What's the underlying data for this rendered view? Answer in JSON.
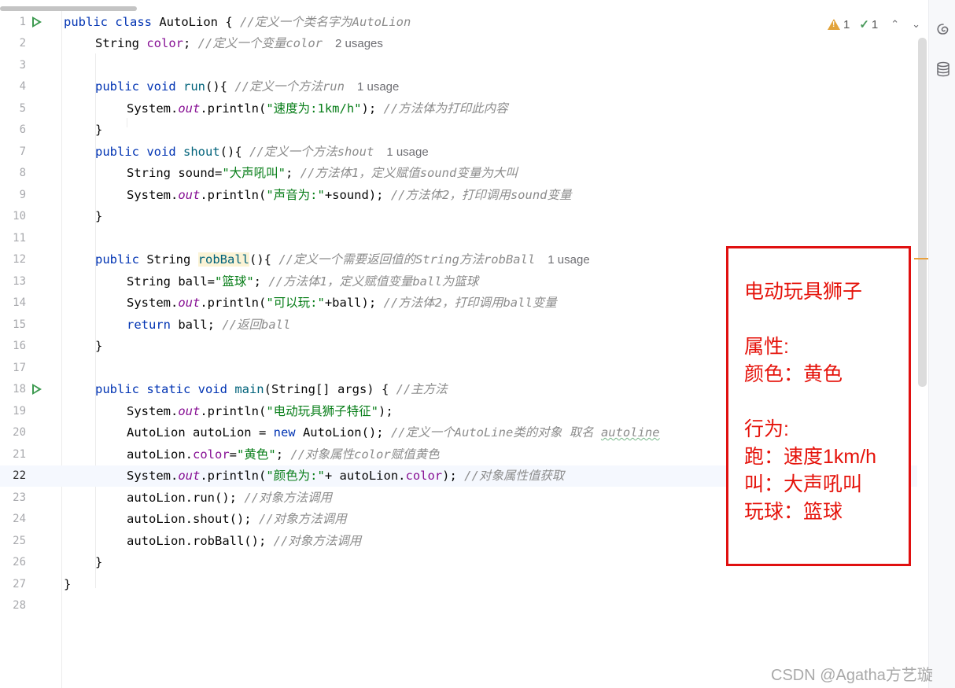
{
  "editor": {
    "usage_one": "1 usage",
    "usage_two": "2 usages",
    "current_line": 22,
    "lines": [
      {
        "n": "1",
        "run": true
      },
      {
        "n": "2"
      },
      {
        "n": "3"
      },
      {
        "n": "4"
      },
      {
        "n": "5"
      },
      {
        "n": "6"
      },
      {
        "n": "7"
      },
      {
        "n": "8"
      },
      {
        "n": "9"
      },
      {
        "n": "10"
      },
      {
        "n": "11"
      },
      {
        "n": "12"
      },
      {
        "n": "13"
      },
      {
        "n": "14"
      },
      {
        "n": "15"
      },
      {
        "n": "16"
      },
      {
        "n": "17"
      },
      {
        "n": "18",
        "run": true
      },
      {
        "n": "19"
      },
      {
        "n": "20"
      },
      {
        "n": "21"
      },
      {
        "n": "22"
      },
      {
        "n": "23"
      },
      {
        "n": "24"
      },
      {
        "n": "25"
      },
      {
        "n": "26"
      },
      {
        "n": "27"
      },
      {
        "n": "28"
      }
    ],
    "code": {
      "l1": {
        "kw": "public class ",
        "name": "AutoLion",
        "rest": " { ",
        "comment": "//定义一个类名字为AutoLion"
      },
      "l2": {
        "type": "String ",
        "field": "color",
        "rest": "; ",
        "comment": "//定义一个变量color"
      },
      "l4": {
        "kw": "public void ",
        "fn": "run",
        "rest": "(){ ",
        "comment": "//定义一个方法run"
      },
      "l5": {
        "a": "System.",
        "b": "out",
        "c": ".println(",
        "s": "\"速度为:1km/h\"",
        "d": "); ",
        "comment": "//方法体为打印此内容"
      },
      "l6": {
        "t": "}"
      },
      "l7": {
        "kw": "public void ",
        "fn": "shout",
        "rest": "(){ ",
        "comment": "//定义一个方法shout"
      },
      "l8": {
        "a": "String sound=",
        "s": "\"大声吼叫\"",
        "d": "; ",
        "comment": "//方法体1，定义赋值sound变量为大叫"
      },
      "l9": {
        "a": "System.",
        "b": "out",
        "c": ".println(",
        "s": "\"声音为:\"",
        "d": "+sound); ",
        "comment": "//方法体2，打印调用sound变量"
      },
      "l10": {
        "t": "}"
      },
      "l12": {
        "kw": "public ",
        "type": "String ",
        "fn": "robBall",
        "rest": "(){ ",
        "comment": "//定义一个需要返回值的String方法robBall"
      },
      "l13": {
        "a": "String ball=",
        "s": "\"篮球\"",
        "d": "; ",
        "comment": "//方法体1，定义赋值变量ball为篮球"
      },
      "l14": {
        "a": "System.",
        "b": "out",
        "c": ".println(",
        "s": "\"可以玩:\"",
        "d": "+ball); ",
        "comment": "//方法体2，打印调用ball变量"
      },
      "l15": {
        "kw": "return ",
        "rest": "ball; ",
        "comment": "//返回ball"
      },
      "l16": {
        "t": "}"
      },
      "l18": {
        "kw": "public static void ",
        "fn": "main",
        "rest": "(String[] args) { ",
        "comment": "//主方法"
      },
      "l19": {
        "a": "System.",
        "b": "out",
        "c": ".println(",
        "s": "\"电动玩具狮子特征\"",
        "d": ");"
      },
      "l20": {
        "a": "AutoLion autoLion = ",
        "kw": "new ",
        "rest": "AutoLion(); ",
        "comment": "//定义一个AutoLine类的对象 取名 ",
        "comment_wavy": "autoline"
      },
      "l21": {
        "a": "autoLion.",
        "field": "color",
        "b": "=",
        "s": "\"黄色\"",
        "d": "; ",
        "comment": "//对象属性color赋值黄色"
      },
      "l22": {
        "a": "System.",
        "b": "out",
        "c": ".println(",
        "s": "\"颜色为:\"",
        "d": "+ autoLion.",
        "field": "color",
        "e": "); ",
        "comment": "//对象属性值获取"
      },
      "l23": {
        "a": "autoLion.run(); ",
        "comment": "//对象方法调用"
      },
      "l24": {
        "a": "autoLion.shout(); ",
        "comment": "//对象方法调用"
      },
      "l25": {
        "a": "autoLion.robBall(); ",
        "comment": "//对象方法调用"
      },
      "l26": {
        "t": "}"
      },
      "l27": {
        "t": "}"
      }
    }
  },
  "inspections": {
    "warnings": "1",
    "checks": "1",
    "up_arrow": "⌃",
    "down_arrow": "⌄"
  },
  "annotation": {
    "title": "电动玩具狮子",
    "attributes_heading": "属性:",
    "attribute_color": "颜色：黄色",
    "behaviors_heading": "行为:",
    "behavior_run": "跑：速度1km/h",
    "behavior_shout": "叫：大声吼叫",
    "behavior_play": "玩球：篮球"
  },
  "watermark": "CSDN @Agatha方艺璇",
  "colors": {
    "keyword": "#0033b3",
    "string": "#067d17",
    "comment": "#8c8c8c",
    "field": "#871094",
    "note_red": "#e01010"
  },
  "side_icons": [
    "swirl-icon",
    "database-icon"
  ]
}
